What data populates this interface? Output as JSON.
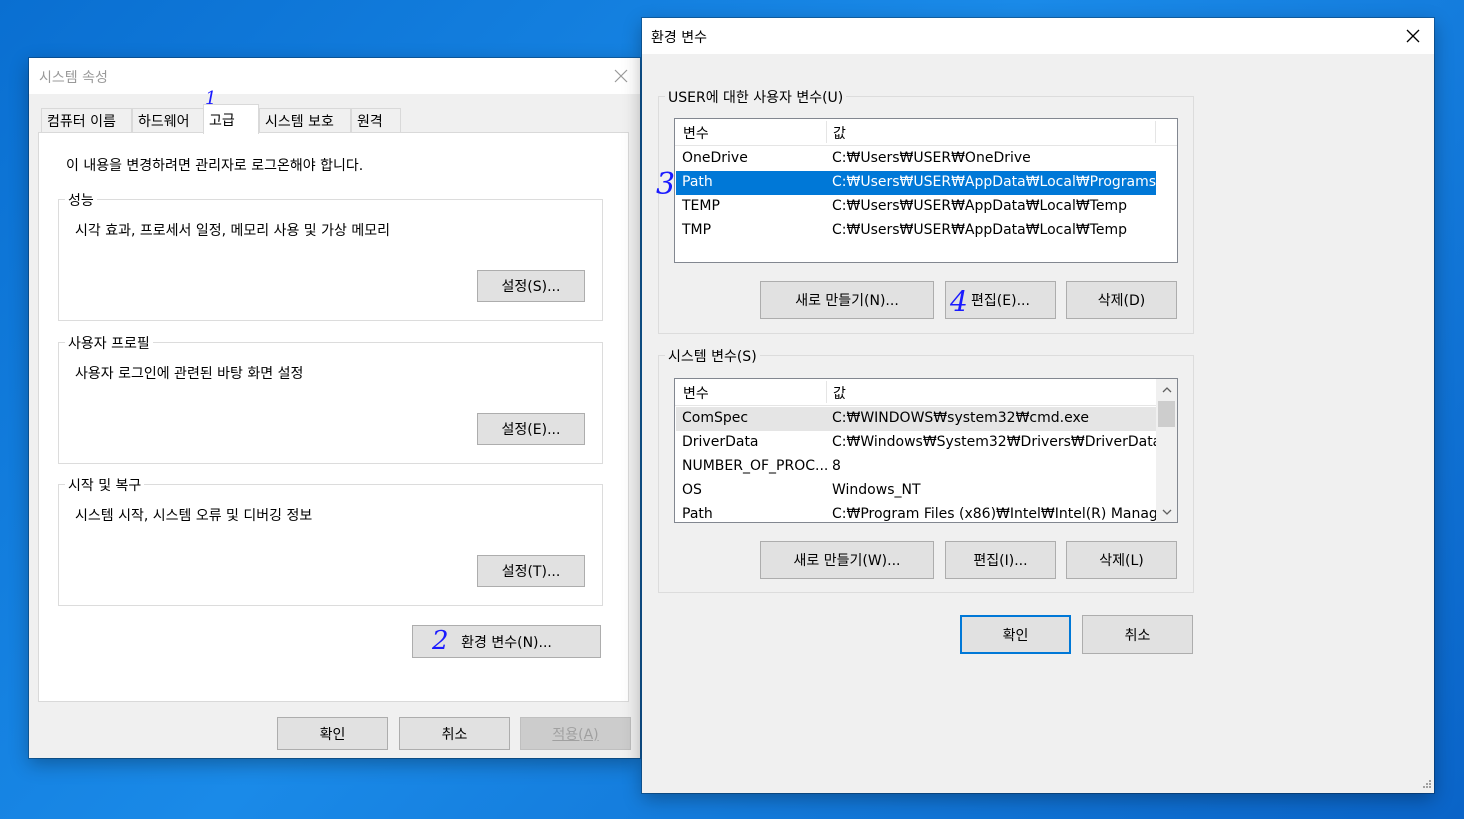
{
  "system_properties": {
    "title": "시스템 속성",
    "tabs": [
      "컴퓨터 이름",
      "하드웨어",
      "고급",
      "시스템 보호",
      "원격"
    ],
    "admin_notice": "이 내용을 변경하려면 관리자로 로그온해야 합니다.",
    "performance": {
      "title": "성능",
      "description": "시각 효과, 프로세서 일정, 메모리 사용 및 가상 메모리",
      "button": "설정(S)..."
    },
    "user_profile": {
      "title": "사용자 프로필",
      "description": "사용자 로그인에 관련된 바탕 화면 설정",
      "button": "설정(E)..."
    },
    "startup_recovery": {
      "title": "시작 및 복구",
      "description": "시스템 시작, 시스템 오류 및 디버깅 정보",
      "button": "설정(T)..."
    },
    "env_button": "환경 변수(N)...",
    "ok": "확인",
    "cancel": "취소",
    "apply": "적용(A)"
  },
  "env_vars": {
    "title": "환경 변수",
    "user_group": "USER에 대한 사용자 변수(U)",
    "col_variable": "변수",
    "col_value": "값",
    "user_vars": [
      {
        "name": "OneDrive",
        "value": "C:₩Users₩USER₩OneDrive"
      },
      {
        "name": "Path",
        "value": "C:₩Users₩USER₩AppData₩Local₩Programs..."
      },
      {
        "name": "TEMP",
        "value": "C:₩Users₩USER₩AppData₩Local₩Temp"
      },
      {
        "name": "TMP",
        "value": "C:₩Users₩USER₩AppData₩Local₩Temp"
      }
    ],
    "user_new": "새로 만들기(N)...",
    "user_edit": "편집(E)...",
    "user_delete": "삭제(D)",
    "system_group": "시스템 변수(S)",
    "system_vars": [
      {
        "name": "ComSpec",
        "value": "C:₩WINDOWS₩system32₩cmd.exe"
      },
      {
        "name": "DriverData",
        "value": "C:₩Windows₩System32₩Drivers₩DriverData"
      },
      {
        "name": "NUMBER_OF_PROC...",
        "value": "8"
      },
      {
        "name": "OS",
        "value": "Windows_NT"
      },
      {
        "name": "Path",
        "value": "C:₩Program Files (x86)₩Intel₩Intel(R) Manag..."
      }
    ],
    "sys_new": "새로 만들기(W)...",
    "sys_edit": "편집(I)...",
    "sys_delete": "삭제(L)",
    "ok": "확인",
    "cancel": "취소"
  },
  "annotations": {
    "step1": "1",
    "step2": "2",
    "step3": "3",
    "step4": "4"
  },
  "colors": {
    "selection": "#0078d7",
    "accent": "#0078d7",
    "ink": "#1a1aff"
  },
  "icons": {
    "close": "close-icon",
    "scroll_up": "chevron-up-icon",
    "scroll_down": "chevron-down-icon",
    "resize": "resize-grip-icon"
  }
}
